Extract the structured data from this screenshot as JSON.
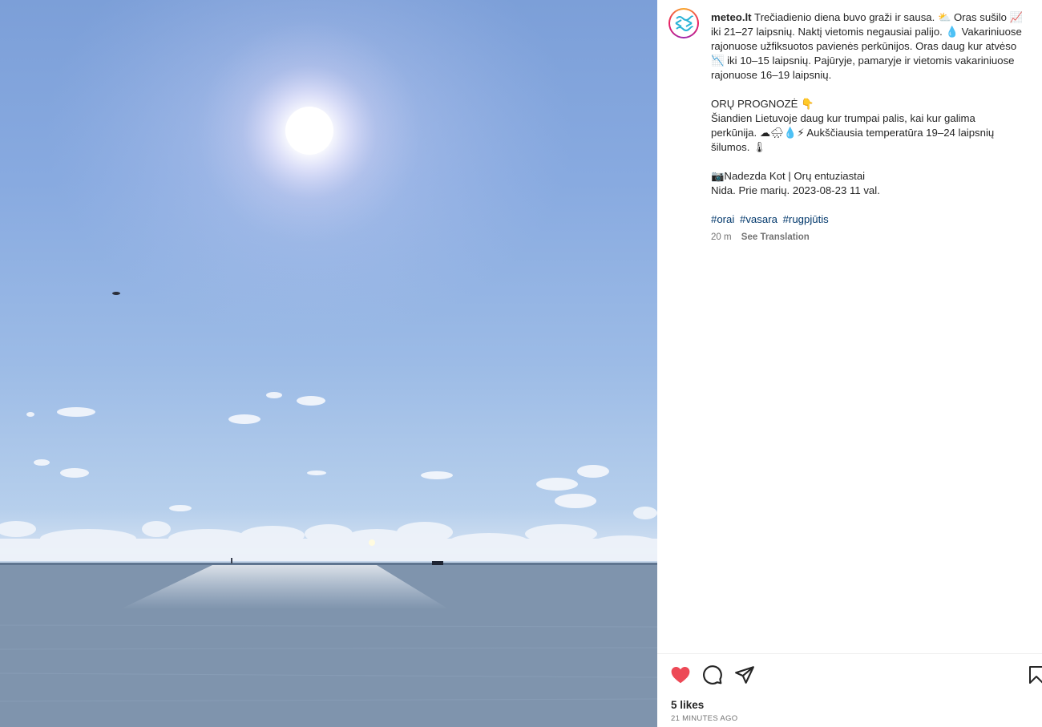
{
  "post": {
    "username": "meteo.lt",
    "caption_lines": [
      "Trečiadienio diena buvo graži ir sausa. ⛅ Oras sušilo 📈",
      "iki 21–27 laipsnių. Naktį vietomis negausiai palijo. 💧 Vakariniuose",
      "rajonuose užfiksuotos pavienės perkūnijos. Oras daug kur atvėso",
      "📉 iki 10–15 laipsnių. Pajūryje, pamaryje ir vietomis vakariniuose",
      "rajonuose 16–19 laipsnių.",
      "",
      "ORŲ PROGNOZĖ 👇",
      "Šiandien Lietuvoje daug kur trumpai palis, kai kur galima",
      "perkūnija. ☁🌧💧⚡ Aukščiausia temperatūra 19–24 laipsnių",
      "šilumos. 🌡",
      "",
      "📷Nadezda Kot | Orų entuziastai",
      "Nida. Prie marių. 2023-08-23 11 val.",
      ""
    ],
    "hashtags": [
      "#orai",
      "#vasara",
      "#rugpjūtis"
    ],
    "time_short": "20 m",
    "see_translation": "See Translation",
    "likes": "5 likes",
    "time_ago": "21 MINUTES AGO"
  },
  "icons": {
    "like": "heart-filled-icon",
    "comment": "comment-icon",
    "share": "send-icon",
    "save": "bookmark-icon"
  },
  "colors": {
    "like_red": "#ed4956",
    "hashtag_blue": "#00376b",
    "secondary_text": "#737373"
  }
}
